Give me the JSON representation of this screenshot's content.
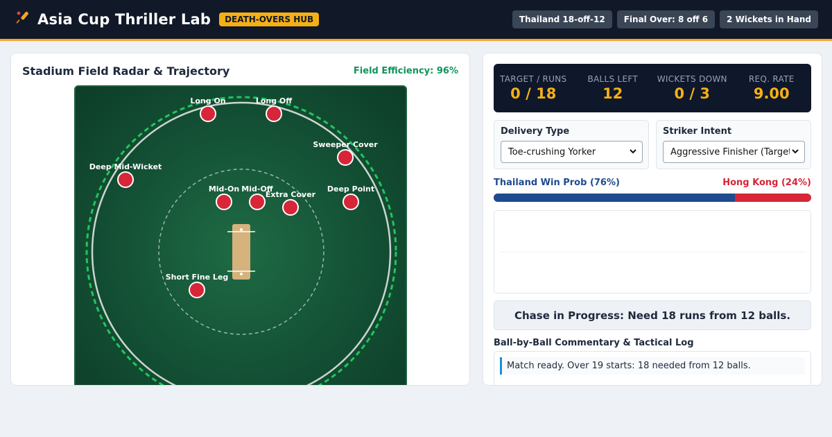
{
  "header": {
    "icon": "cricket-bat-icon",
    "title": "Asia Cup Thriller Lab",
    "badge": "DEATH-OVERS HUB",
    "pills": [
      "Thailand 18-off-12",
      "Final Over: 8 off 6",
      "2 Wickets in Hand"
    ]
  },
  "field_panel": {
    "title": "Stadium Field Radar & Trajectory",
    "efficiency": "Field Efficiency: 96%",
    "fielders": [
      {
        "name": "Long On"
      },
      {
        "name": "Long Off"
      },
      {
        "name": "Sweeper Cover"
      },
      {
        "name": "Deep Mid-Wicket"
      },
      {
        "name": "Mid-On"
      },
      {
        "name": "Mid-Off"
      },
      {
        "name": "Extra Cover"
      },
      {
        "name": "Deep Point"
      },
      {
        "name": "Short Fine Leg"
      }
    ],
    "colors": {
      "fielder": "#d62638",
      "boundary_ring": "#22c55e",
      "pitch": "#d6b27c"
    }
  },
  "scoreboard": [
    {
      "label": "TARGET / RUNS",
      "value": "0 / 18"
    },
    {
      "label": "BALLS LEFT",
      "value": "12"
    },
    {
      "label": "WICKETS DOWN",
      "value": "0 / 3"
    },
    {
      "label": "REQ. RATE",
      "value": "9.00"
    }
  ],
  "controls": {
    "delivery": {
      "label": "Delivery Type",
      "value": "Toe-crushing Yorker"
    },
    "intent": {
      "label": "Striker Intent",
      "value": "Aggressive Finisher (Target Gap)"
    }
  },
  "win_prob": {
    "team_a_label": "Thailand Win Prob (76%)",
    "team_b_label": "Hong Kong (24%)",
    "team_a_pct": 76,
    "colors": {
      "team_a": "#1e4b8f",
      "team_b": "#d62638"
    }
  },
  "status": "Chase in Progress: Need 18 runs from 12 balls.",
  "log": {
    "title": "Ball-by-Ball Commentary & Tactical Log",
    "entries": [
      "Match ready. Over 19 starts: 18 needed from 12 balls."
    ]
  }
}
